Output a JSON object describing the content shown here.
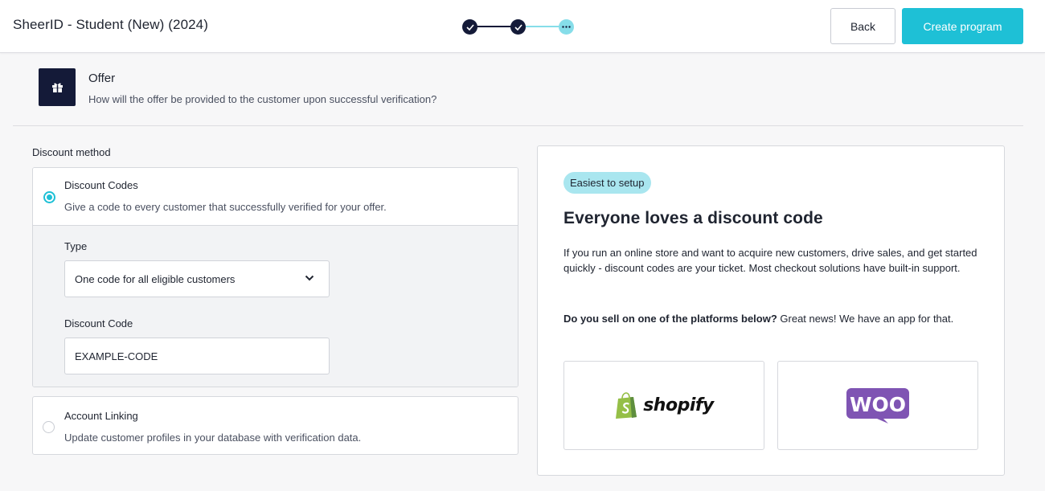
{
  "header": {
    "title": "SheerID - Student (New) (2024)",
    "back_label": "Back",
    "create_label": "Create program",
    "stepper": {
      "total_steps": 3,
      "completed_steps": 2,
      "current_step": 3,
      "current_glyph": "···"
    }
  },
  "section": {
    "icon": "gift-icon",
    "title": "Offer",
    "subtitle": "How will the offer be provided to the customer upon successful verification?"
  },
  "discount_method": {
    "label": "Discount method",
    "options": [
      {
        "title": "Discount Codes",
        "description": "Give a code to every customer that successfully verified for your offer.",
        "selected": true
      },
      {
        "title": "Account Linking",
        "description": "Update customer profiles in your database with verification data.",
        "selected": false
      }
    ],
    "type_label": "Type",
    "type_value": "One code for all eligible customers",
    "code_label": "Discount Code",
    "code_value": "EXAMPLE-CODE"
  },
  "info_panel": {
    "pill": "Easiest to setup",
    "title": "Everyone loves a discount code",
    "body": "If you run an online store and want to acquire new customers, drive sales, and get started quickly - discount codes are your ticket. Most checkout solutions have built-in support.",
    "platforms_question": "Do you sell on one of the platforms below?",
    "platforms_answer": " Great news! We have an app for that.",
    "platforms": [
      {
        "name": "shopify",
        "logo_text": "shopify",
        "logo_color": "#95bf47"
      },
      {
        "name": "woocommerce",
        "logo_text": "WOO",
        "logo_color": "#7f54b3"
      }
    ]
  },
  "colors": {
    "accent": "#1ec0d6",
    "navy": "#141a38",
    "pill_bg": "#a9e6ef"
  }
}
